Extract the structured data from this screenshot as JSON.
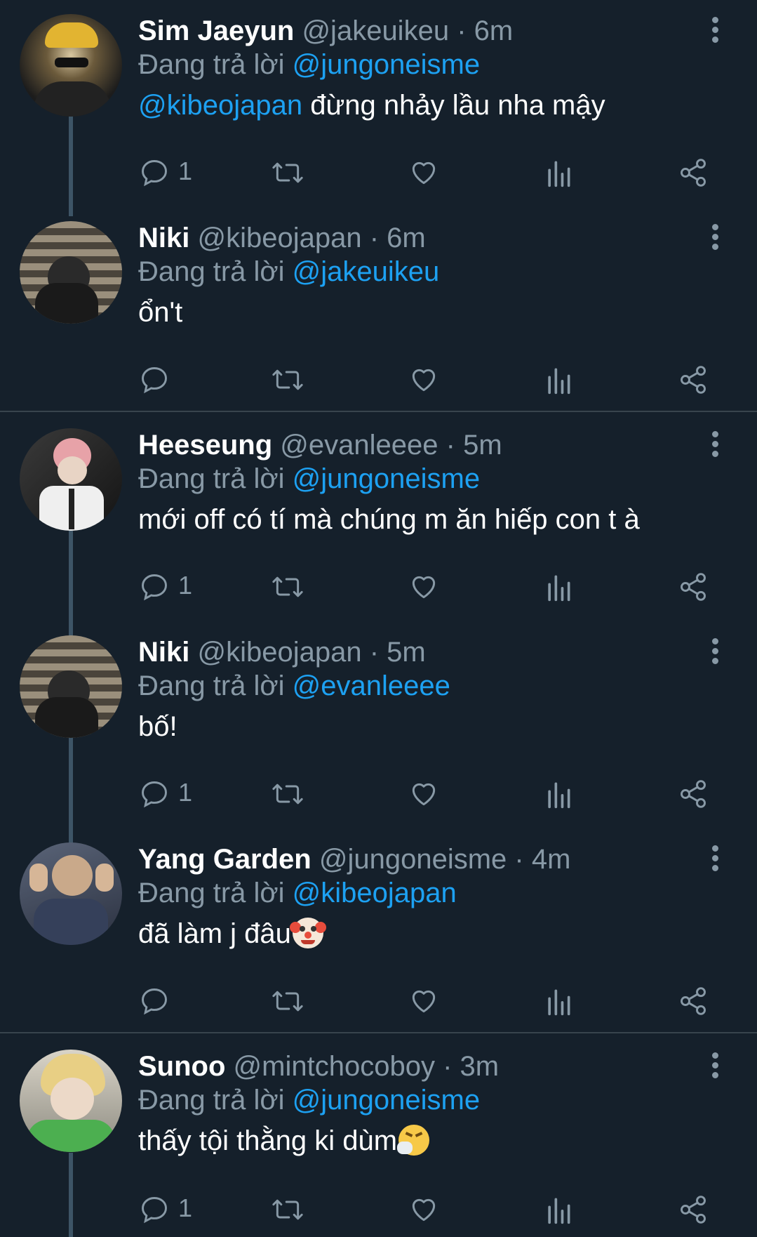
{
  "tweets": [
    {
      "name": "Sim Jaeyun",
      "handle": "@jakeuikeu",
      "time": "6m",
      "replying_label": "Đang trả lời",
      "replying_to": "@jungoneisme",
      "mention": "@kibeojapan",
      "text": " đừng nhảy lầu nha mậy",
      "reply_count": "1"
    },
    {
      "name": "Niki",
      "handle": "@kibeojapan",
      "time": "6m",
      "replying_label": "Đang trả lời",
      "replying_to": "@jakeuikeu",
      "text": "ổn't",
      "reply_count": ""
    },
    {
      "name": "Heeseung",
      "handle": "@evanleeee",
      "time": "5m",
      "replying_label": "Đang trả lời",
      "replying_to": "@jungoneisme",
      "text": "mới off có tí mà chúng m ăn hiếp con t à",
      "reply_count": "1"
    },
    {
      "name": "Niki",
      "handle": "@kibeojapan",
      "time": "5m",
      "replying_label": "Đang trả lời",
      "replying_to": "@evanleeee",
      "text": "bố!",
      "reply_count": "1"
    },
    {
      "name": "Yang Garden",
      "handle": "@jungoneisme",
      "time": "4m",
      "replying_label": "Đang trả lời",
      "replying_to": "@kibeojapan",
      "text": "đã làm j đâu",
      "emoji": "clown-face-emoji",
      "reply_count": ""
    },
    {
      "name": "Sunoo",
      "handle": "@mintchocoboy",
      "time": "3m",
      "replying_label": "Đang trả lời",
      "replying_to": "@jungoneisme",
      "text": "thấy tội thằng ki dùm",
      "emoji": "sneezing-face-emoji",
      "reply_count": "1"
    }
  ],
  "colors": {
    "background": "#15202b",
    "text": "#ffffff",
    "muted": "#8899a6",
    "link": "#1da1f2",
    "divider": "#38444d"
  },
  "icons": [
    "reply-icon",
    "retweet-icon",
    "like-icon",
    "analytics-icon",
    "share-icon",
    "more-icon"
  ]
}
